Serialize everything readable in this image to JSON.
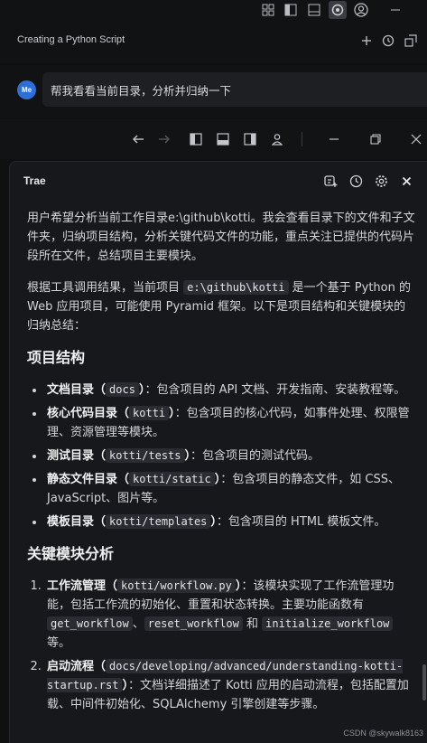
{
  "chat": {
    "title": "Creating a Python Script"
  },
  "user": {
    "avatar_initials": "Me",
    "message": "帮我看看当前目录，分析并归纳一下"
  },
  "panel": {
    "title": "Trae"
  },
  "icons": {
    "topbar": [
      "layout-icon",
      "sidebar-left-icon",
      "panel-icon",
      "copilot-icon",
      "account-icon",
      "minimize-icon"
    ],
    "title_row": [
      "plus-icon",
      "history-icon",
      "new-window-icon"
    ],
    "nav_row": [
      "back-arrow-icon",
      "forward-arrow-icon",
      "toggle-sidebar-icon",
      "toggle-panel-icon",
      "toggle-right-icon",
      "account-icon",
      "minimize-icon",
      "restore-icon",
      "close-icon"
    ],
    "panel_head": [
      "add-chat-icon",
      "history-icon",
      "settings-icon",
      "close-icon"
    ]
  },
  "response": {
    "para1": "用户希望分析当前工作目录e:\\github\\kotti。我会查看目录下的文件和子文件夹，归纳项目结构，分析关键代码文件的功能，重点关注已提供的代码片段所在文件，总结项目主要模块。",
    "para2_pre": "根据工具调用结果，当前项目 ",
    "para2_code": "e:\\github\\kotti",
    "para2_post": " 是一个基于 Python 的 Web 应用项目，可能使用 Pyramid 框架。以下是项目结构和关键模块的归纳总结：",
    "heading1": "项目结构",
    "structure": [
      {
        "label": "文档目录",
        "code": "docs",
        "desc": "：包含项目的 API 文档、开发指南、安装教程等。"
      },
      {
        "label": "核心代码目录",
        "code": "kotti",
        "desc": "：包含项目的核心代码，如事件处理、权限管理、资源管理等模块。"
      },
      {
        "label": "测试目录",
        "code": "kotti/tests",
        "desc": "：包含项目的测试代码。"
      },
      {
        "label": "静态文件目录",
        "code": "kotti/static",
        "desc": "：包含项目的静态文件，如 CSS、JavaScript、图片等。"
      },
      {
        "label": "模板目录",
        "code": "kotti/templates",
        "desc": "：包含项目的 HTML 模板文件。"
      }
    ],
    "heading2": "关键模块分析",
    "modules": [
      {
        "label": "工作流管理",
        "code": "kotti/workflow.py",
        "desc": "：该模块实现了工作流管理功能，包括工作流的初始化、重置和状态转换。主要功能函数有 ",
        "fn1": "get_workflow",
        "sep1": "、",
        "fn2": "reset_workflow",
        "sep2": " 和 ",
        "fn3": "initialize_workflow",
        "end": " 等。"
      },
      {
        "label": "启动流程",
        "code": "docs/developing/advanced/understanding-kotti-startup.rst",
        "desc": "：文档详细描述了 Kotti 应用的启动流程，包括配置加载、中间件初始化、SQLAlchemy 引擎创建等步骤。"
      }
    ]
  },
  "watermark": "CSDN @skywalk8163"
}
